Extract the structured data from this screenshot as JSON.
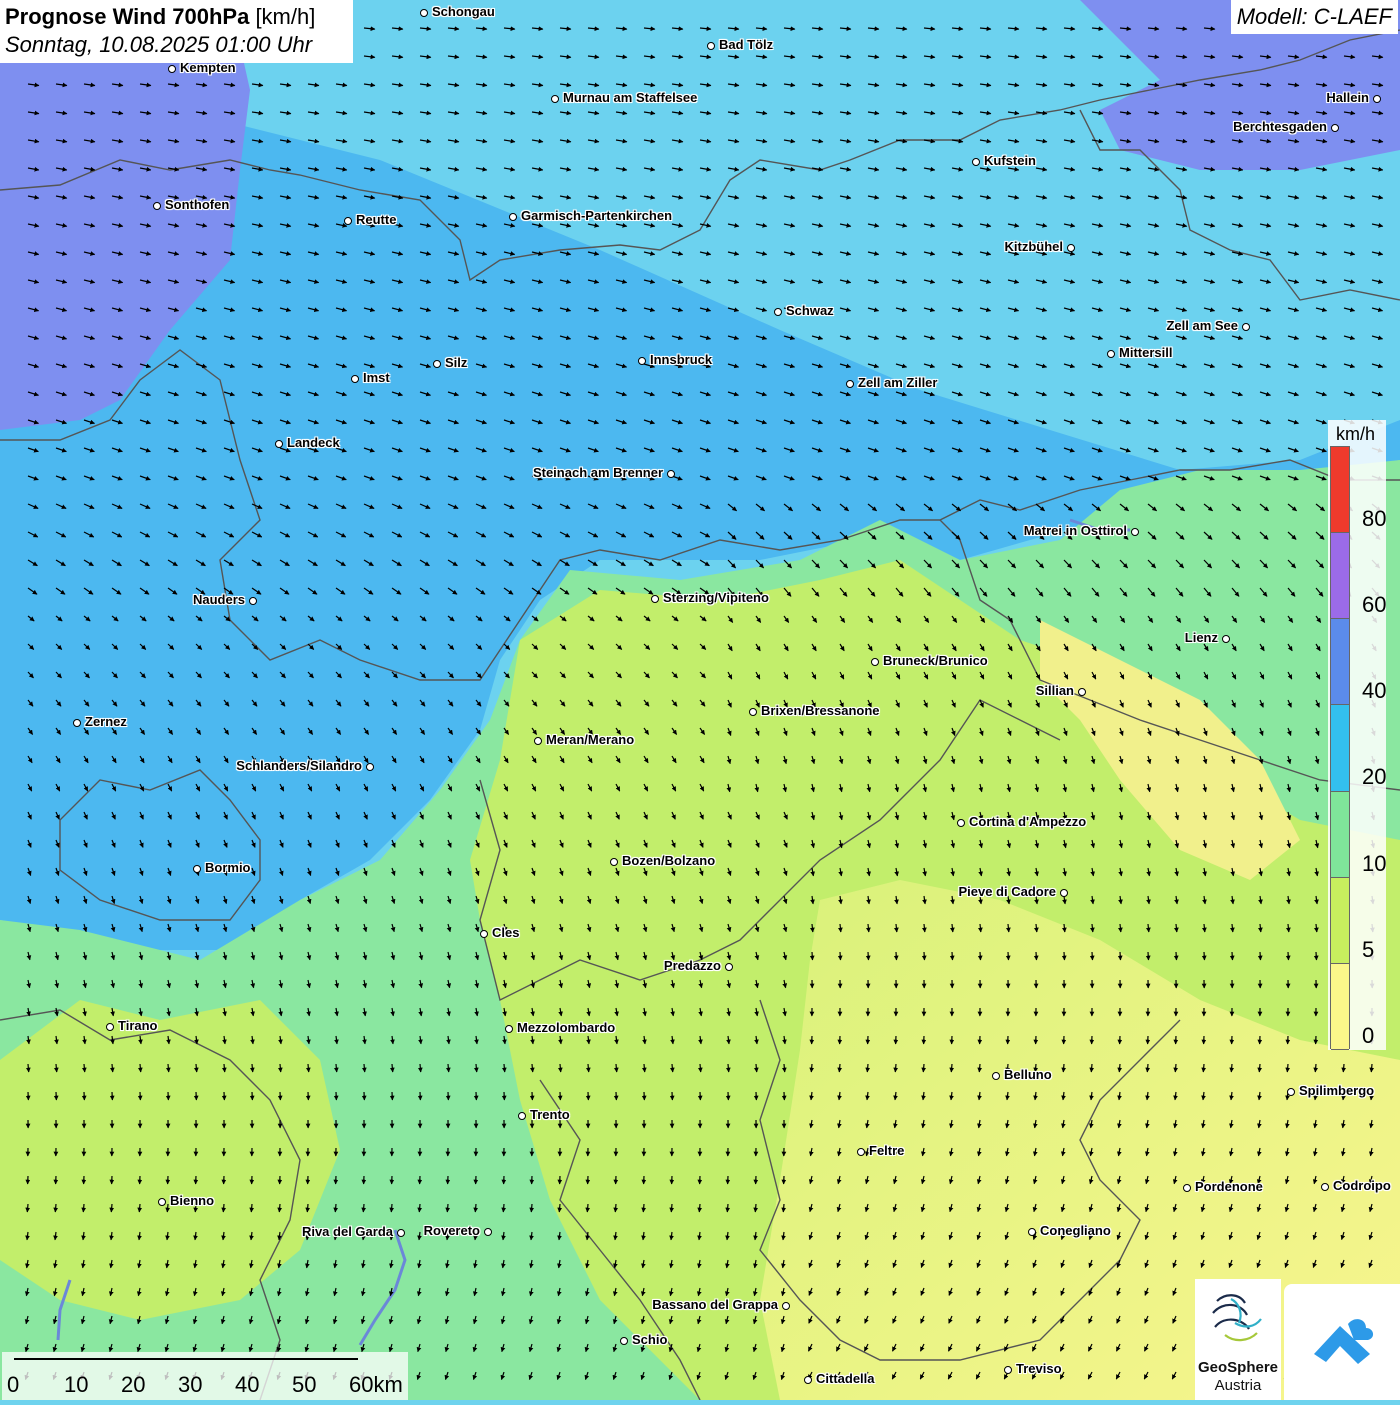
{
  "title": {
    "bold": "Prognose Wind 700hPa",
    "unit": "[km/h]",
    "datetime": "Sonntag, 10.08.2025 01:00 Uhr"
  },
  "model": "Modell: C-LAEF",
  "legend": {
    "unit": "km/h",
    "ticks": [
      "80",
      "60",
      "40",
      "20",
      "10",
      "5",
      "0"
    ],
    "colors": [
      "#ef3a2c",
      "#9b6be8",
      "#5b8bea",
      "#33c0ee",
      "#7fe59a",
      "#c7ef5e",
      "#fbf78a"
    ]
  },
  "scalebar": {
    "labels": [
      "0",
      "10",
      "20",
      "30",
      "40",
      "50",
      "60km"
    ]
  },
  "cities": [
    {
      "name": "Schongau"
    },
    {
      "name": "Bad Tölz"
    },
    {
      "name": "Kempten"
    },
    {
      "name": "Murnau am Staffelsee"
    },
    {
      "name": "Hallein"
    },
    {
      "name": "Berchtesgaden"
    },
    {
      "name": "Kufstein"
    },
    {
      "name": "Sonthofen"
    },
    {
      "name": "Reutte"
    },
    {
      "name": "Garmisch-Partenkirchen"
    },
    {
      "name": "Kitzbühel"
    },
    {
      "name": "Schwaz"
    },
    {
      "name": "Zell am See"
    },
    {
      "name": "Mittersill"
    },
    {
      "name": "Silz"
    },
    {
      "name": "Innsbruck"
    },
    {
      "name": "Imst"
    },
    {
      "name": "Zell am Ziller"
    },
    {
      "name": "Landeck"
    },
    {
      "name": "Steinach am Brenner"
    },
    {
      "name": "Matrei in Osttirol"
    },
    {
      "name": "Nauders"
    },
    {
      "name": "Sterzing/Vipiteno"
    },
    {
      "name": "Lienz"
    },
    {
      "name": "Bruneck/Brunico"
    },
    {
      "name": "Sillian"
    },
    {
      "name": "Zernez"
    },
    {
      "name": "Brixen/Bressanone"
    },
    {
      "name": "Meran/Merano"
    },
    {
      "name": "Schlanders/Silandro"
    },
    {
      "name": "Cortina d'Ampezzo"
    },
    {
      "name": "Bozen/Bolzano"
    },
    {
      "name": "Bormio"
    },
    {
      "name": "Pieve di Cadore"
    },
    {
      "name": "Cles"
    },
    {
      "name": "Predazzo"
    },
    {
      "name": "Tirano"
    },
    {
      "name": "Mezzolombardo"
    },
    {
      "name": "Belluno"
    },
    {
      "name": "Spilimbergo"
    },
    {
      "name": "Trento"
    },
    {
      "name": "Feltre"
    },
    {
      "name": "Pordenone"
    },
    {
      "name": "Codroipo"
    },
    {
      "name": "Bienno"
    },
    {
      "name": "Riva del Garda"
    },
    {
      "name": "Rovereto"
    },
    {
      "name": "Conegliano"
    },
    {
      "name": "Bassano del Grappa"
    },
    {
      "name": "Schio"
    },
    {
      "name": "Treviso"
    },
    {
      "name": "Cittadella"
    }
  ],
  "logo": {
    "line1": "GeoSphere",
    "line2": "Austria"
  }
}
